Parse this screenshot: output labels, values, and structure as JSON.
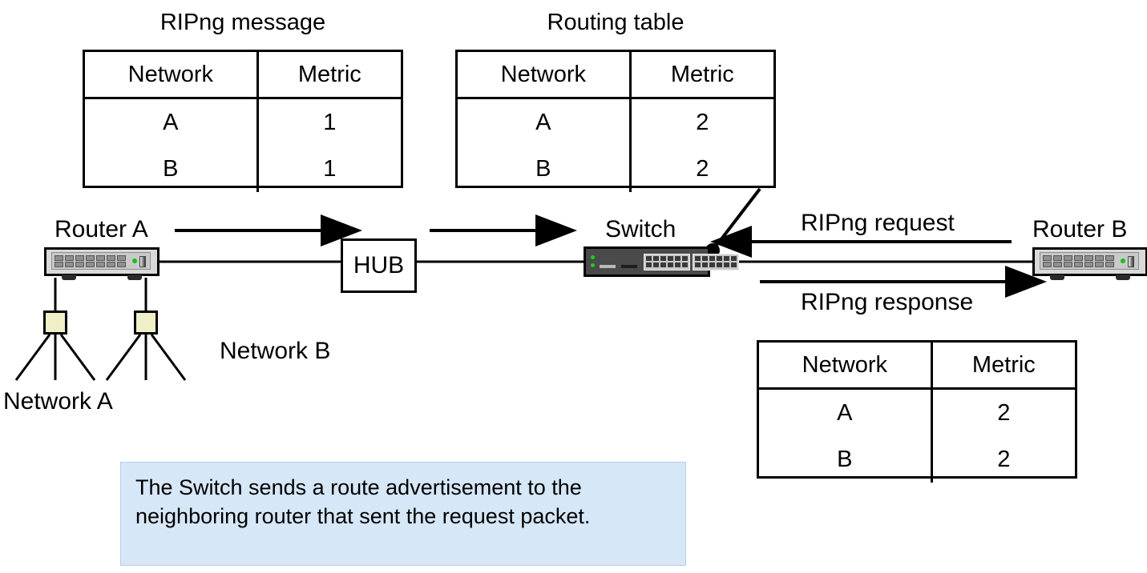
{
  "diagram": {
    "title_ripng_message": "RIPng message",
    "title_routing_table": "Routing table"
  },
  "tables": {
    "ripng_message": {
      "title": "RIPng message",
      "columns": [
        "Network",
        "Metric"
      ],
      "rows": [
        {
          "network": "A",
          "metric": "1"
        },
        {
          "network": "B",
          "metric": "1"
        }
      ]
    },
    "routing_table": {
      "title": "Routing table",
      "columns": [
        "Network",
        "Metric"
      ],
      "rows": [
        {
          "network": "A",
          "metric": "2"
        },
        {
          "network": "B",
          "metric": "2"
        }
      ]
    },
    "advertised_table": {
      "columns": [
        "Network",
        "Metric"
      ],
      "rows": [
        {
          "network": "A",
          "metric": "2"
        },
        {
          "network": "B",
          "metric": "2"
        }
      ]
    }
  },
  "nodes": {
    "router_a": "Router A",
    "router_b": "Router B",
    "hub": "HUB",
    "switch": "Switch"
  },
  "networks": {
    "network_a": "Network A",
    "network_b": "Network B"
  },
  "flows": {
    "ripng_request": "RIPng request",
    "ripng_response": "RIPng response"
  },
  "callout": {
    "text": "The Switch sends a route advertisement to the neighboring router that sent the request packet."
  },
  "colors": {
    "callout_background": "#d6e7f8",
    "callout_border": "#b5cfe6",
    "lan_node": "#efefc8",
    "stroke": "#000000",
    "switch_body": "#4a4a4a",
    "router_body": "#d9d9d9",
    "led_green": "#12c212"
  }
}
